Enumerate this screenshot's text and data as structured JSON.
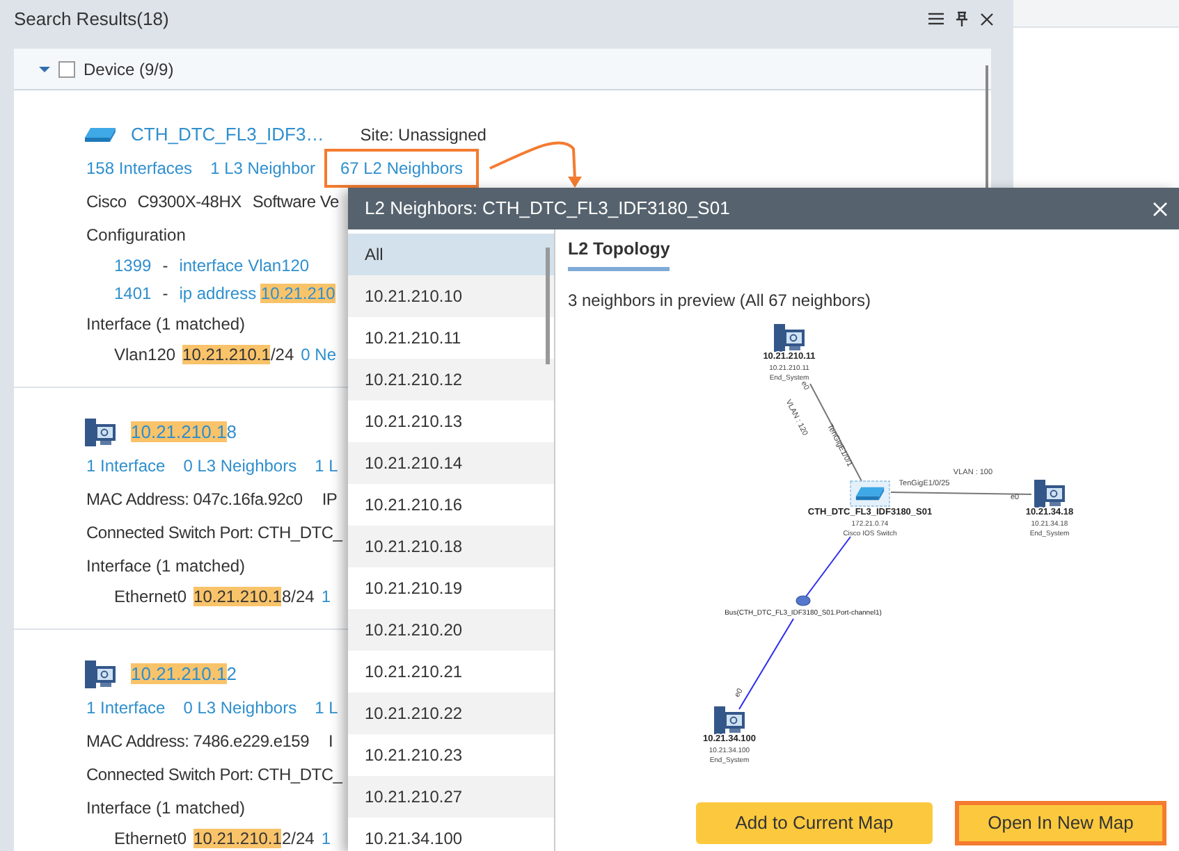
{
  "panel": {
    "title": "Search Results(18)"
  },
  "group": {
    "label": "Device (9/9)",
    "expanded": true,
    "checked": false
  },
  "devices": [
    {
      "kind": "switch",
      "name": [
        {
          "text": "CTH_DTC_FL3_IDF3…",
          "highlighted": false
        }
      ],
      "site": "Site: Unassigned",
      "links": [
        {
          "text": "158 Interfaces",
          "outlined": false
        },
        {
          "text": "1 L3 Neighbor",
          "outlined": false
        },
        {
          "text": "67 L2 Neighbors",
          "outlined": true
        }
      ],
      "info_rows": [
        [
          "Cisco",
          "C9300X-48HX",
          "Software Ve"
        ]
      ],
      "configuration": {
        "title": "Configuration",
        "lines": [
          {
            "number": "1399",
            "sep": "-",
            "segments": [
              {
                "text": "interface Vlan120",
                "highlighted": false
              }
            ]
          },
          {
            "number": "1401",
            "sep": "-",
            "segments": [
              {
                "text": "ip address ",
                "highlighted": false
              },
              {
                "text": "10.21.210",
                "highlighted": true
              }
            ]
          }
        ]
      },
      "interface": {
        "title": "Interface (1 matched)",
        "name": "Vlan120",
        "segments": [
          {
            "text": "10.21.210.1",
            "highlighted": true
          },
          {
            "text": "/24",
            "highlighted": false
          }
        ],
        "extra": "0 Ne"
      }
    },
    {
      "kind": "server",
      "name": [
        {
          "text": "10.21.210.1",
          "highlighted": true
        },
        {
          "text": "8",
          "highlighted": false
        }
      ],
      "links": [
        {
          "text": "1 Interface",
          "outlined": false
        },
        {
          "text": "0 L3 Neighbors",
          "outlined": false
        },
        {
          "text": "1 L",
          "outlined": false
        }
      ],
      "info_rows": [
        [
          "MAC Address: 047c.16fa.92c0",
          "IP"
        ],
        [
          "Connected Switch Port: CTH_DTC_"
        ]
      ],
      "interface": {
        "title": "Interface (1 matched)",
        "name": "Ethernet0",
        "segments": [
          {
            "text": "10.21.210.1",
            "highlighted": true
          },
          {
            "text": "8/24",
            "highlighted": false
          }
        ],
        "extra": "1"
      }
    },
    {
      "kind": "server",
      "name": [
        {
          "text": "10.21.210.1",
          "highlighted": true
        },
        {
          "text": "2",
          "highlighted": false
        }
      ],
      "links": [
        {
          "text": "1 Interface",
          "outlined": false
        },
        {
          "text": "0 L3 Neighbors",
          "outlined": false
        },
        {
          "text": "1 L",
          "outlined": false
        }
      ],
      "info_rows": [
        [
          "MAC Address: 7486.e229.e159",
          "I"
        ],
        [
          "Connected Switch Port: CTH_DTC_"
        ]
      ],
      "interface": {
        "title": "Interface (1 matched)",
        "name": "Ethernet0",
        "segments": [
          {
            "text": "10.21.210.1",
            "highlighted": true
          },
          {
            "text": "2/24",
            "highlighted": false
          }
        ],
        "extra": "1"
      }
    }
  ],
  "dialog": {
    "title": "L2 Neighbors: CTH_DTC_FL3_IDF3180_S01",
    "list": [
      {
        "label": "All",
        "selected": true
      },
      {
        "label": "10.21.210.10",
        "selected": false
      },
      {
        "label": "10.21.210.11",
        "selected": false
      },
      {
        "label": "10.21.210.12",
        "selected": false
      },
      {
        "label": "10.21.210.13",
        "selected": false
      },
      {
        "label": "10.21.210.14",
        "selected": false
      },
      {
        "label": "10.21.210.16",
        "selected": false
      },
      {
        "label": "10.21.210.18",
        "selected": false
      },
      {
        "label": "10.21.210.19",
        "selected": false
      },
      {
        "label": "10.21.210.20",
        "selected": false
      },
      {
        "label": "10.21.210.21",
        "selected": false
      },
      {
        "label": "10.21.210.22",
        "selected": false
      },
      {
        "label": "10.21.210.23",
        "selected": false
      },
      {
        "label": "10.21.210.27",
        "selected": false
      },
      {
        "label": "10.21.34.100",
        "selected": false
      }
    ],
    "tab": {
      "label": "L2 Topology",
      "selected": true
    },
    "summary": "3 neighbors in preview (All 67 neighbors)",
    "topology": {
      "nodes": [
        {
          "kind": "server",
          "name": "10.21.210.11",
          "address": "10.21.210.11",
          "type": "End_System"
        },
        {
          "kind": "switch",
          "name": "CTH_DTC_FL3_IDF3180_S01",
          "address": "172.21.0.74",
          "type": "Cisco IOS Switch"
        },
        {
          "kind": "server",
          "name": "10.21.34.18",
          "address": "10.21.34.18",
          "type": "End_System"
        },
        {
          "kind": "bus",
          "name": "Bus(CTH_DTC_FL3_IDF3180_S01.Port-channel1)"
        },
        {
          "kind": "server",
          "name": "10.21.34.100",
          "address": "10.21.34.100",
          "type": "End_System"
        }
      ],
      "links": [
        {
          "color": "#777777",
          "labels": [
            "e0",
            "VLAN : 120",
            "TenGigE1/0/1"
          ]
        },
        {
          "color": "#777777",
          "labels": [
            "TenGigE1/0/25",
            "VLAN : 100",
            "e0"
          ]
        },
        {
          "color": "#2b2bf0"
        },
        {
          "color": "#2b2bf0",
          "labels": [
            "e0"
          ]
        }
      ]
    },
    "buttons": [
      {
        "label": "Add to Current Map",
        "outlined": false
      },
      {
        "label": "Open In New Map",
        "outlined": true
      }
    ]
  }
}
